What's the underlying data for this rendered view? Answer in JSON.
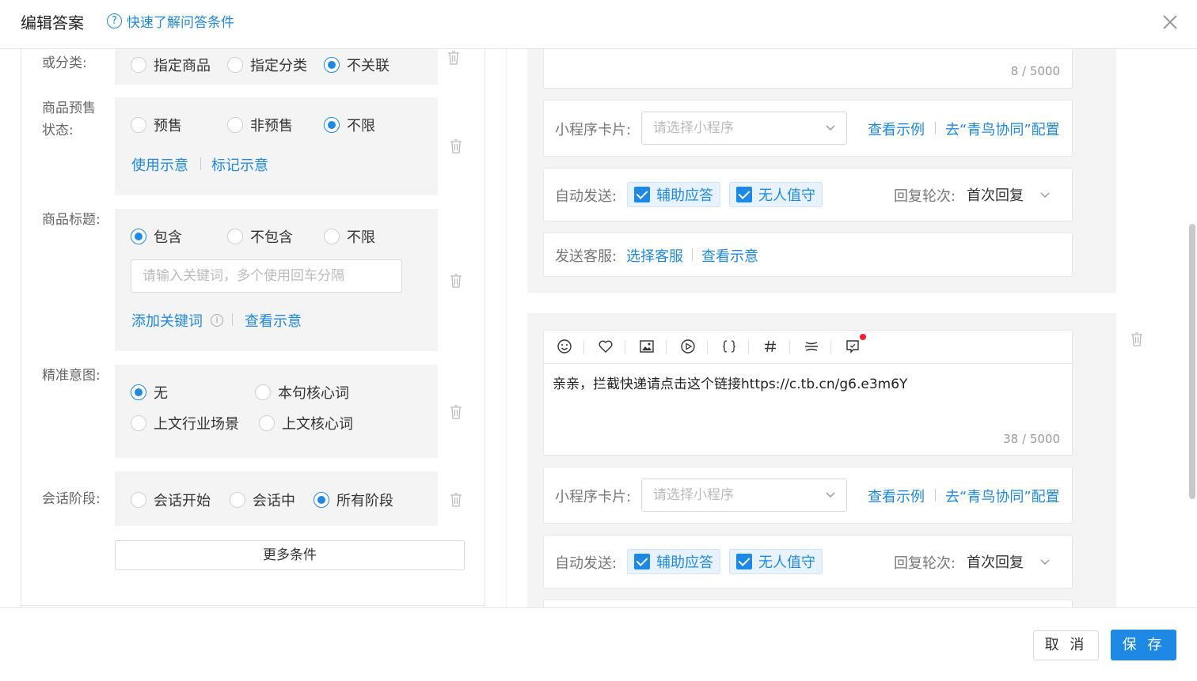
{
  "header": {
    "title": "编辑答案",
    "help_icon": "?",
    "help_link": "快速了解问答条件"
  },
  "conditions": {
    "category": {
      "label": "或分类:",
      "options": [
        "指定商品",
        "指定分类",
        "不关联"
      ],
      "selected": "不关联"
    },
    "presale": {
      "label_line1": "商品预售",
      "label_line2": "状态:",
      "options": [
        "预售",
        "非预售",
        "不限"
      ],
      "selected": "不限",
      "link_use": "使用示意",
      "link_mark": "标记示意"
    },
    "title": {
      "label": "商品标题:",
      "options": [
        "包含",
        "不包含",
        "不限"
      ],
      "selected": "包含",
      "placeholder": "请输入关键词，多个使用回车分隔",
      "add_keyword": "添加关键词",
      "info_icon": "i",
      "view_example": "查看示意"
    },
    "intent": {
      "label": "精准意图:",
      "options": [
        "无",
        "本句核心词",
        "上文行业场景",
        "上文核心词"
      ],
      "selected": "无"
    },
    "stage": {
      "label": "会话阶段:",
      "options": [
        "会话开始",
        "会话中",
        "所有阶段"
      ],
      "selected": "所有阶段"
    },
    "more_button": "更多条件"
  },
  "answers": {
    "first": {
      "counter": "8 / 5000",
      "mini_program_label": "小程序卡片:",
      "mini_program_placeholder": "请选择小程序",
      "view_example": "查看示例",
      "configure": "去“青鸟协同”配置",
      "auto_send_label": "自动发送:",
      "auto_send_options": [
        "辅助应答",
        "无人值守"
      ],
      "reply_round_label": "回复轮次:",
      "reply_round_value": "首次回复",
      "send_agent_label": "发送客服:",
      "choose_agent": "选择客服",
      "view_sample": "查看示意"
    },
    "second": {
      "toolbar_icons": [
        "smile-icon",
        "heart-icon",
        "image-icon",
        "video-icon",
        "braces-icon",
        "hash-icon",
        "divider-icon",
        "comment-icon"
      ],
      "content": "亲亲，拦截快递请点击这个链接https://c.tb.cn/g6.e3m6Y",
      "counter": "38 / 5000",
      "mini_program_label": "小程序卡片:",
      "mini_program_placeholder": "请选择小程序",
      "view_example": "查看示例",
      "configure": "去“青鸟协同”配置",
      "auto_send_label": "自动发送:",
      "auto_send_options": [
        "辅助应答",
        "无人值守"
      ],
      "reply_round_label": "回复轮次:",
      "reply_round_value": "首次回复"
    }
  },
  "footer": {
    "cancel": "取 消",
    "save": "保 存"
  },
  "colors": {
    "accent": "#1e88e5",
    "panel_bg": "#f4f4f4",
    "notification_dot": "#f5222d"
  }
}
